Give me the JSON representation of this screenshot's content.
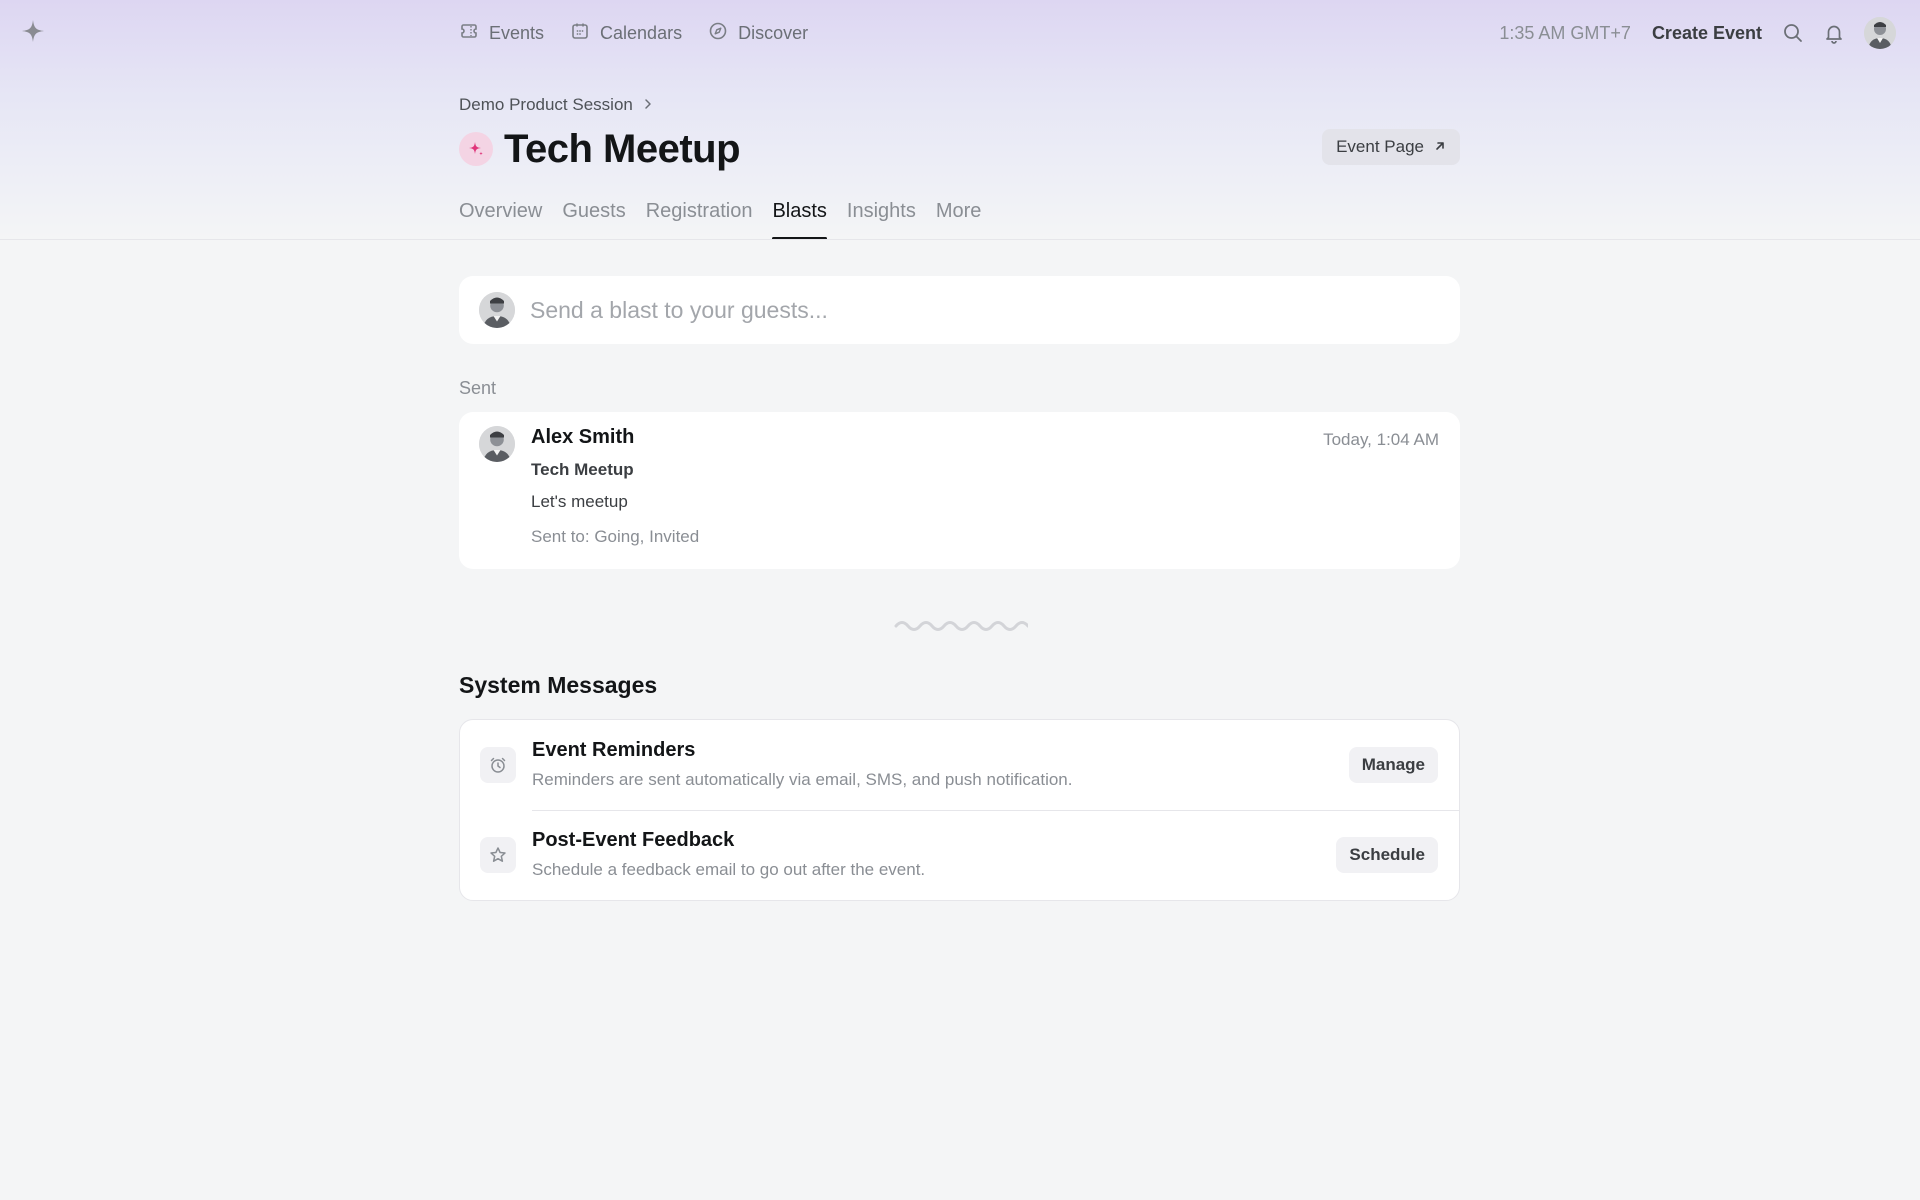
{
  "topbar": {
    "logo_icon": "sparkle-star-icon",
    "nav": [
      {
        "label": "Events",
        "icon": "ticket-icon"
      },
      {
        "label": "Calendars",
        "icon": "calendar-icon"
      },
      {
        "label": "Discover",
        "icon": "compass-icon"
      }
    ],
    "clock": "1:35 AM GMT+7",
    "create_event": "Create Event"
  },
  "header": {
    "breadcrumb": "Demo Product Session",
    "title": "Tech Meetup",
    "event_page_button": "Event Page"
  },
  "tabs": [
    {
      "label": "Overview",
      "active": false
    },
    {
      "label": "Guests",
      "active": false
    },
    {
      "label": "Registration",
      "active": false
    },
    {
      "label": "Blasts",
      "active": true
    },
    {
      "label": "Insights",
      "active": false
    },
    {
      "label": "More",
      "active": false
    }
  ],
  "blast": {
    "placeholder": "Send a blast to your guests..."
  },
  "sent": {
    "section_label": "Sent",
    "items": [
      {
        "sender": "Alex Smith",
        "time": "Today, 1:04 AM",
        "subject": "Tech Meetup",
        "message": "Let's meetup",
        "sent_to": "Sent to: Going, Invited"
      }
    ]
  },
  "system_messages": {
    "title": "System Messages",
    "items": [
      {
        "name": "Event Reminders",
        "description": "Reminders are sent automatically via email, SMS, and push notification.",
        "button": "Manage",
        "icon": "alarm-clock-icon"
      },
      {
        "name": "Post-Event Feedback",
        "description": "Schedule a feedback email to go out after the event.",
        "button": "Schedule",
        "icon": "star-icon"
      }
    ]
  },
  "colors": {
    "accent_pink": "#e0357a",
    "text_primary": "#131517",
    "text_muted": "#8a8e94",
    "page_bg": "#f4f5f6"
  }
}
